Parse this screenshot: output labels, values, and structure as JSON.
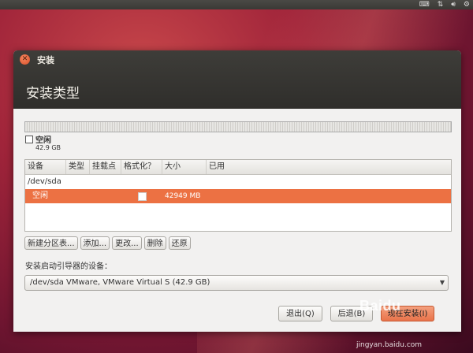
{
  "window": {
    "title": "安装",
    "heading": "安装类型"
  },
  "legend": {
    "label": "空闲",
    "size": "42.9 GB"
  },
  "table": {
    "headers": [
      "设备",
      "类型",
      "挂载点",
      "格式化？",
      "大小",
      "已用"
    ],
    "device": "/dev/sda",
    "selected_row": {
      "name": "空闲",
      "formatted": false,
      "size": "42949 MB"
    }
  },
  "buttons": {
    "new_table": "新建分区表...",
    "add": "添加...",
    "change": "更改...",
    "delete": "删除",
    "revert": "还原"
  },
  "bootloader": {
    "label": "安装启动引导器的设备：",
    "value": "/dev/sda  VMware, VMware Virtual S (42.9 GB)"
  },
  "footer": {
    "quit": "退出(Q)",
    "back": "后退(B)",
    "install": "现在安装(I)"
  },
  "tray": {
    "keyboard": "keyboard-icon",
    "network": "network-icon",
    "volume": "volume-icon",
    "settings": "gear-icon"
  },
  "watermark": {
    "logo": "Baidu",
    "url": "jingyan.baidu.com"
  },
  "colors": {
    "accent": "#ec7143",
    "titlebar": "#3a3935"
  }
}
